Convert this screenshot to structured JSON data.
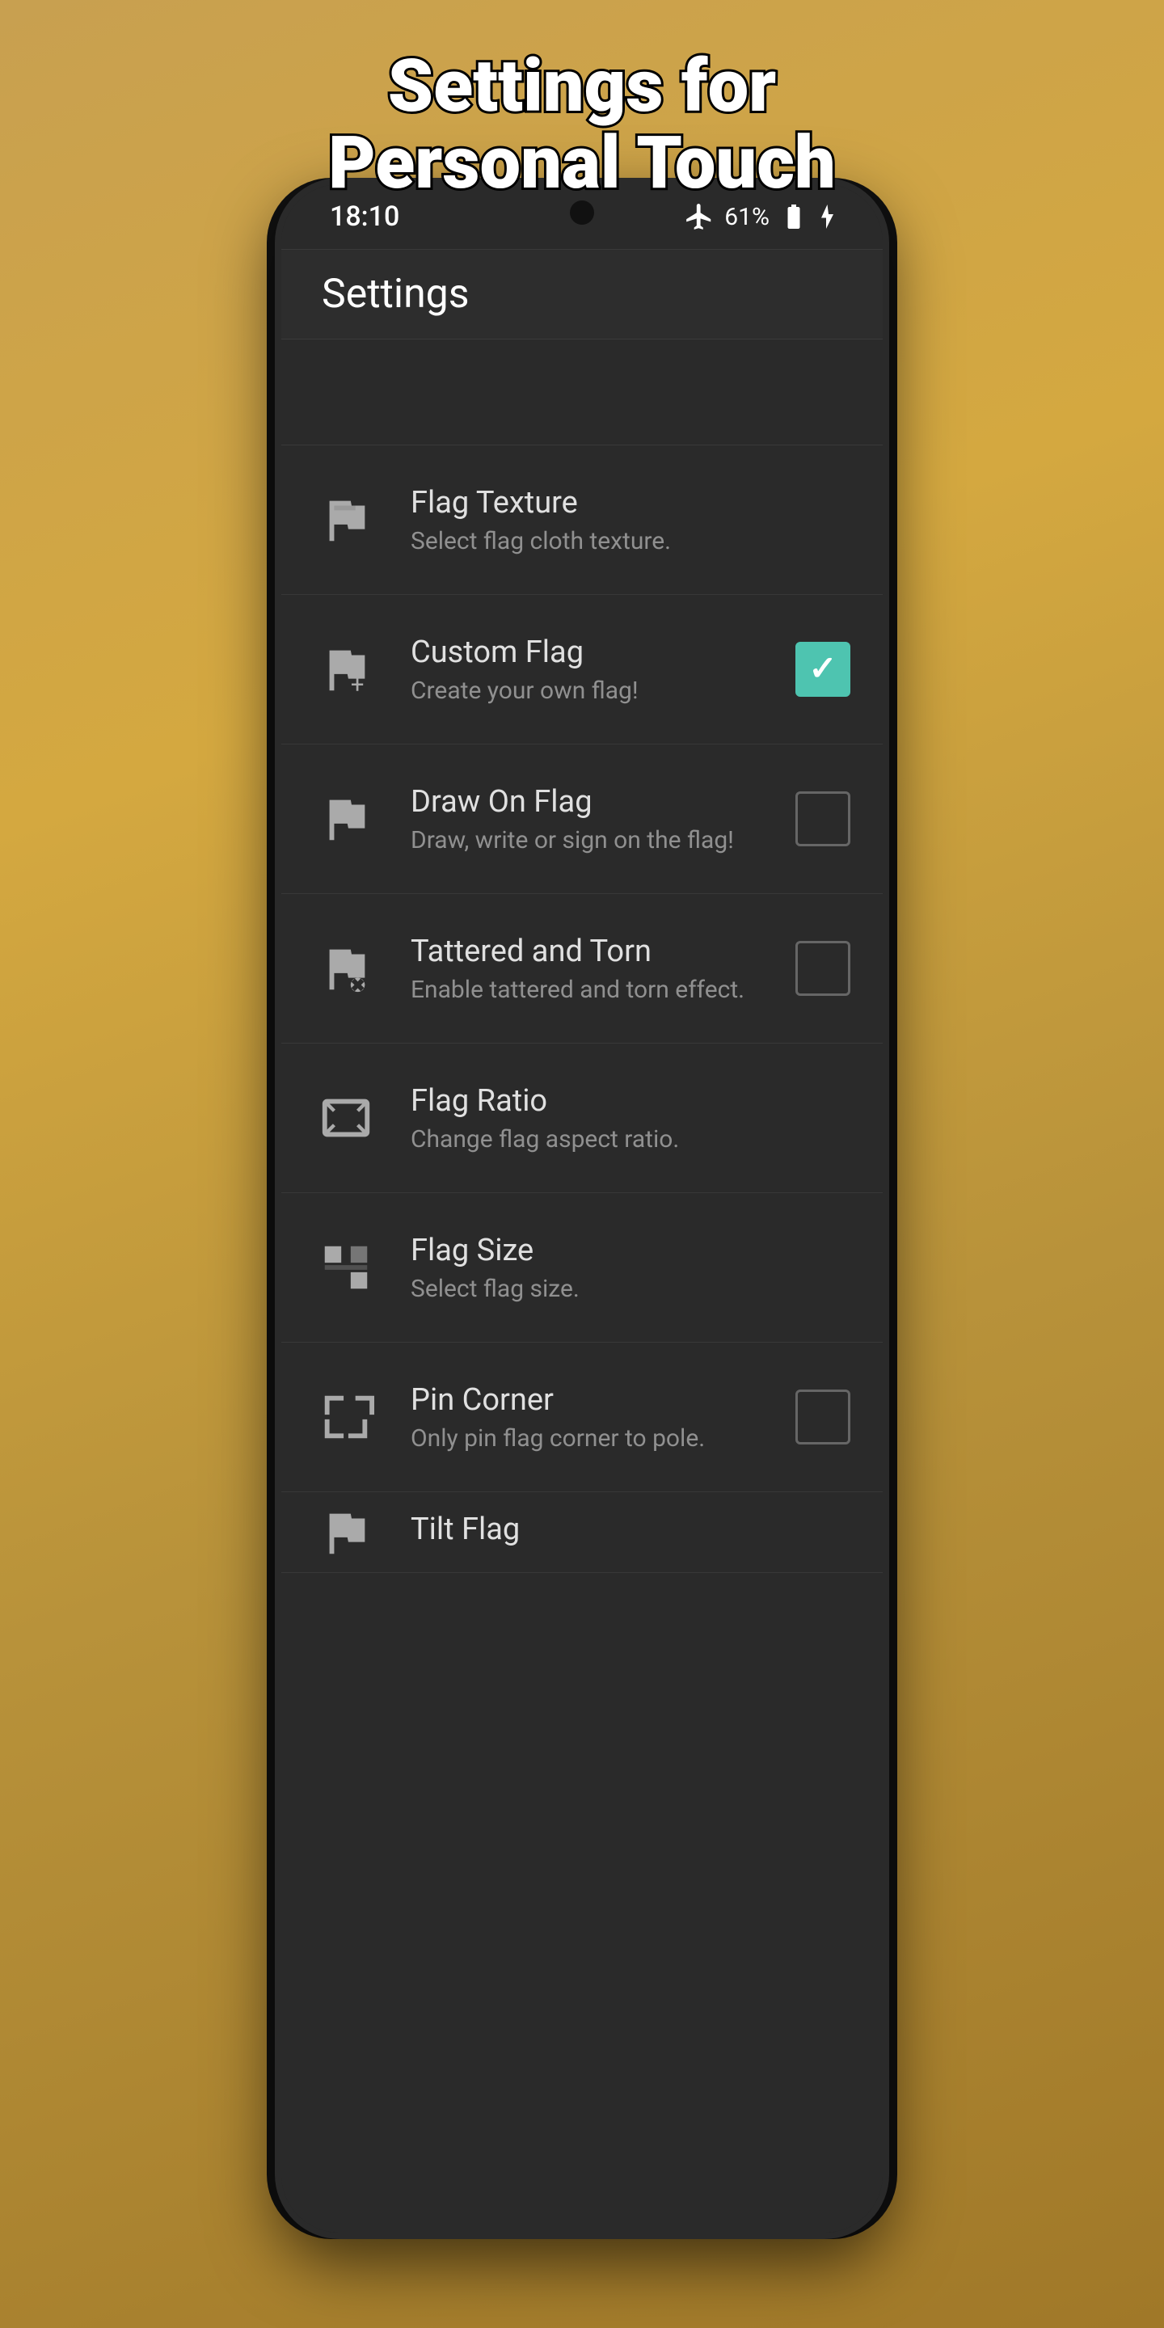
{
  "page": {
    "bg_title_line1": "Settings for",
    "bg_title_line2": "Personal Touch"
  },
  "status_bar": {
    "time": "18:10",
    "battery": "61%",
    "airplane_mode": true
  },
  "app_bar": {
    "title": "Settings"
  },
  "settings_items": [
    {
      "id": "flag-texture",
      "title": "Flag Texture",
      "subtitle": "Select flag cloth texture.",
      "icon": "flag-texture-icon",
      "has_checkbox": false
    },
    {
      "id": "custom-flag",
      "title": "Custom Flag",
      "subtitle": "Create your own flag!",
      "icon": "custom-flag-icon",
      "has_checkbox": true,
      "checked": true
    },
    {
      "id": "draw-on-flag",
      "title": "Draw On Flag",
      "subtitle": "Draw, write or sign on the flag!",
      "icon": "draw-flag-icon",
      "has_checkbox": true,
      "checked": false
    },
    {
      "id": "tattered-torn",
      "title": "Tattered and Torn",
      "subtitle": "Enable tattered and torn effect.",
      "icon": "tattered-icon",
      "has_checkbox": true,
      "checked": false
    },
    {
      "id": "flag-ratio",
      "title": "Flag Ratio",
      "subtitle": "Change flag aspect ratio.",
      "icon": "flag-ratio-icon",
      "has_checkbox": false
    },
    {
      "id": "flag-size",
      "title": "Flag Size",
      "subtitle": "Select flag size.",
      "icon": "flag-size-icon",
      "has_checkbox": false
    },
    {
      "id": "pin-corner",
      "title": "Pin Corner",
      "subtitle": "Only pin flag corner to pole.",
      "icon": "pin-corner-icon",
      "has_checkbox": true,
      "checked": false
    },
    {
      "id": "tilt-flag",
      "title": "Tilt Flag",
      "subtitle": "",
      "icon": "tilt-flag-icon",
      "has_checkbox": false,
      "partial": true
    }
  ]
}
